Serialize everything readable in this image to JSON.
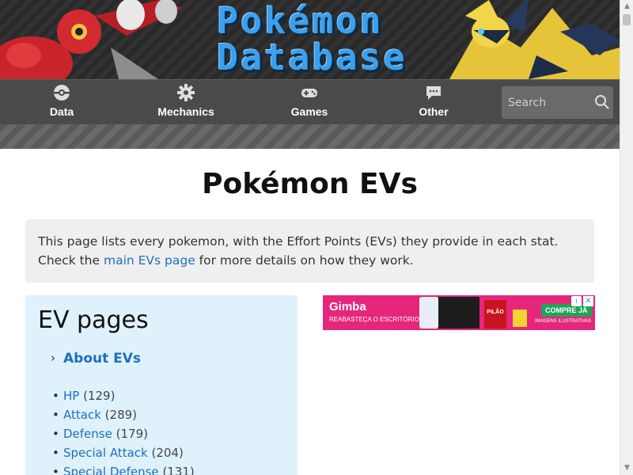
{
  "site": {
    "logo_line1": "Pokémon",
    "logo_line2": "Database"
  },
  "nav": {
    "items": [
      {
        "label": "Data",
        "icon": "pokeball-icon"
      },
      {
        "label": "Mechanics",
        "icon": "gear-icon"
      },
      {
        "label": "Games",
        "icon": "gamepad-icon"
      },
      {
        "label": "Other",
        "icon": "chat-bubble-icon"
      }
    ],
    "search_placeholder": "Search"
  },
  "page": {
    "title": "Pokémon EVs",
    "intro_text_before": "This page lists every pokemon, with the Effort Points (EVs) they provide in each stat. Check the ",
    "intro_link": "main EVs page",
    "intro_text_after": " for more details on how they work."
  },
  "ev_pages": {
    "heading": "EV pages",
    "about_link": "About EVs",
    "stats": [
      {
        "name": "HP",
        "count": "(129)"
      },
      {
        "name": "Attack",
        "count": "(289)"
      },
      {
        "name": "Defense",
        "count": "(179)"
      },
      {
        "name": "Special Attack",
        "count": "(204)"
      },
      {
        "name": "Special Defense",
        "count": "(131)"
      }
    ]
  },
  "ad": {
    "brand": "Gimba",
    "subtitle": "REABASTEÇA O ESCRITÓRIO",
    "cta": "COMPRE JÁ",
    "note": "IMAGENS ILUSTRATIVAS",
    "product_label": "PILÃO"
  },
  "colors": {
    "link": "#1c6fc0",
    "nav_bg": "#4a4a4a",
    "ev_box_bg": "#dff2fb",
    "ad_bg": "#e6267a"
  }
}
